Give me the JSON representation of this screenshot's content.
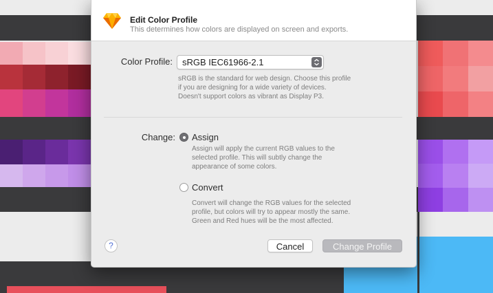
{
  "dialog": {
    "title": "Edit Color Profile",
    "subtitle": "This determines how colors are displayed on screen and exports.",
    "app_icon": "diamond-app-icon",
    "color_profile": {
      "label": "Color Profile:",
      "selected_value": "sRGB IEC61966-2.1",
      "stepper_icon": "up-down-stepper-icon",
      "description": "sRGB is the standard for web design. Choose this profile\nif you are designing for a wide variety of devices.\nDoesn't support colors as vibrant as Display P3."
    },
    "change": {
      "label": "Change:",
      "options": [
        {
          "label": "Assign",
          "selected": true,
          "description": "Assign will apply the current RGB values to the\nselected profile. This will subtly change the\nappearance of some colors."
        },
        {
          "label": "Convert",
          "selected": false,
          "description": "Convert will change the RGB values for the selected\nprofile, but colors will try to appear mostly the same.\nGreen and Red hues will be the most affected."
        }
      ]
    },
    "help_label": "?",
    "cancel_label": "Cancel",
    "confirm_label": "Change Profile"
  },
  "colors": {
    "dark_band": "#3a3a3c",
    "pink_swatches": [
      "#f2aab3",
      "#f6c3c8",
      "#f8d1d5",
      "#fadde0"
    ],
    "red_swatches": [
      "#b9333d",
      "#a52b36",
      "#8e222d",
      "#7a1a25"
    ],
    "magenta_swatches": [
      "#e2457e",
      "#d23e8f",
      "#c2359c",
      "#b12e9e"
    ],
    "purple_swatches": [
      "#4a1f72",
      "#5a2588",
      "#6a2c9b",
      "#7a35ad"
    ],
    "lavender_swatches": [
      "#d6b8ee",
      "#cfa7ec",
      "#c799ea",
      "#c08ee8"
    ],
    "right_red_swatches": [
      "#ef5b5b",
      "#f07275",
      "#f48b8e",
      "#ee6567",
      "#f27b7d",
      "#f2a0a2",
      "#e94a4e",
      "#ee6569",
      "#f38184"
    ],
    "right_purple_swatches": [
      "#9a4fe8",
      "#b070f0",
      "#c59af7",
      "#a35ded",
      "#b980f1",
      "#ccaaf5",
      "#8e3fe2",
      "#a766ec",
      "#be90f2"
    ],
    "right_blue": "#4cb9f6",
    "bottom_red": "#e8505b"
  }
}
